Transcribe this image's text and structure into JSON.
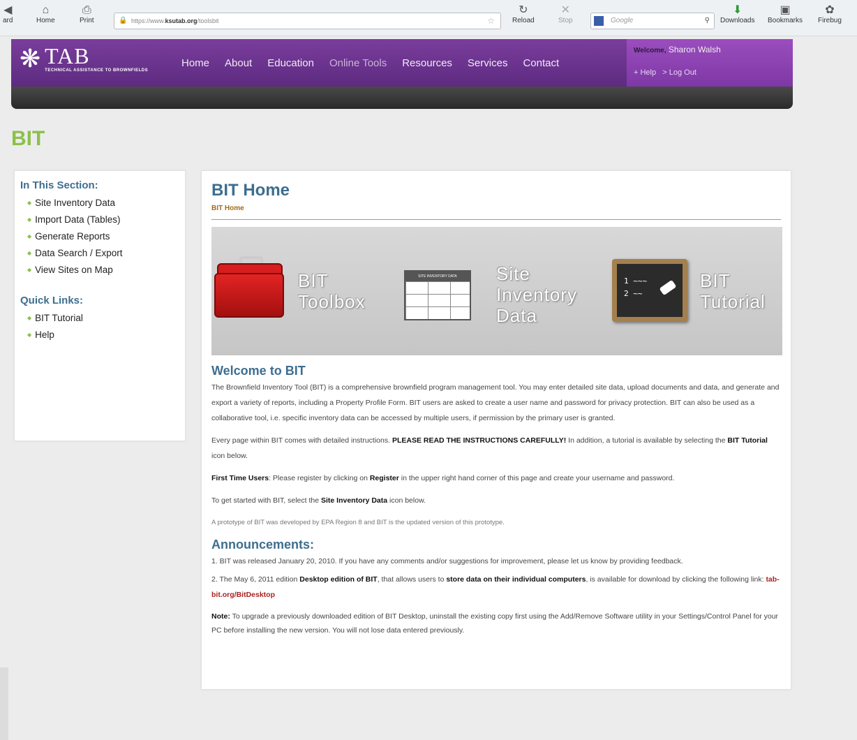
{
  "browser": {
    "back_label": "ard",
    "home_label": "Home",
    "print_label": "Print",
    "url_prefix": "https://www.",
    "url_host": "ksutab.org",
    "url_path": "/toolsbit",
    "reload_label": "Reload",
    "stop_label": "Stop",
    "search_placeholder": "Google",
    "downloads_label": "Downloads",
    "bookmarks_label": "Bookmarks",
    "firebug_label": "Firebug"
  },
  "site": {
    "logo_text": "TAB",
    "logo_subtitle": "TECHNICAL ASSISTANCE TO BROWNFIELDS",
    "nav": [
      "Home",
      "About",
      "Education",
      "Online Tools",
      "Resources",
      "Services",
      "Contact"
    ],
    "welcome_label": "Welcome,",
    "user_name": "Sharon Walsh",
    "help_link": "+ Help",
    "logout_link": "> Log Out"
  },
  "page_title": "BIT",
  "sidebar": {
    "section_heading": "In This Section:",
    "section_items": [
      "Site Inventory Data",
      "Import Data (Tables)",
      "Generate Reports",
      "Data Search / Export",
      "View Sites on Map"
    ],
    "quick_heading": "Quick Links:",
    "quick_items": [
      "BIT Tutorial",
      "Help"
    ]
  },
  "main": {
    "heading": "BIT Home",
    "breadcrumb": "BIT Home",
    "banner": {
      "toolbox_line1": "BIT",
      "toolbox_line2": "Toolbox",
      "sheet_header": "SITE INVENTORY DATA",
      "inventory_line1": "Site",
      "inventory_line2": "Inventory",
      "inventory_line3": "Data",
      "tutorial_line1": "BIT",
      "tutorial_line2": "Tutorial"
    },
    "welcome_heading": "Welcome to BIT",
    "p1": "The Brownfield Inventory Tool (BIT) is a comprehensive brownfield program management tool. You may enter detailed site data, upload documents and data, and generate and export a variety of reports, including a Property Profile Form. BIT users are asked to create a user name and password for privacy protection. BIT can also be used as a collaborative tool, i.e. specific inventory data can be accessed by multiple users, if permission by the primary user is granted.",
    "p2_a": "Every page within BIT comes with detailed instructions. ",
    "p2_b": "PLEASE READ THE INSTRUCTIONS CAREFULLY!",
    "p2_c": " In addition, a tutorial is available by selecting the ",
    "p2_d": "BIT Tutorial",
    "p2_e": " icon below.",
    "p3_a": "First Time Users",
    "p3_b": ": Please register by clicking on ",
    "p3_c": "Register",
    "p3_d": " in the upper right hand corner of this page and create your username and password.",
    "p4_a": "To get started with BIT, select the ",
    "p4_b": "Site Inventory Data",
    "p4_c": " icon below.",
    "p5": "A prototype of BIT was developed by EPA Region 8 and BIT is the updated version of this prototype.",
    "announce_heading": "Announcements:",
    "a1": "1. BIT was released January 20, 2010. If you have any comments and/or suggestions for improvement, please let us know by providing feedback.",
    "a2_a": "2. The May 6, 2011 edition ",
    "a2_b": "Desktop edition of BIT",
    "a2_c": ", that allows users to ",
    "a2_d": "store data on their individual computers",
    "a2_e": ", is available for download by clicking the following link: ",
    "a2_link": "tab-bit.org/BitDesktop",
    "note_label": "Note:",
    "note_text": " To upgrade a previously downloaded edition of BIT Desktop, uninstall the existing copy first using the Add/Remove Software utility in your Settings/Control Panel for your PC before installing the new version. You will not lose data entered previously."
  },
  "colors": {
    "purple": "#6b3390",
    "green_accent": "#8cc04a",
    "heading_blue": "#3d6e8f",
    "link_red": "#aa2222"
  }
}
